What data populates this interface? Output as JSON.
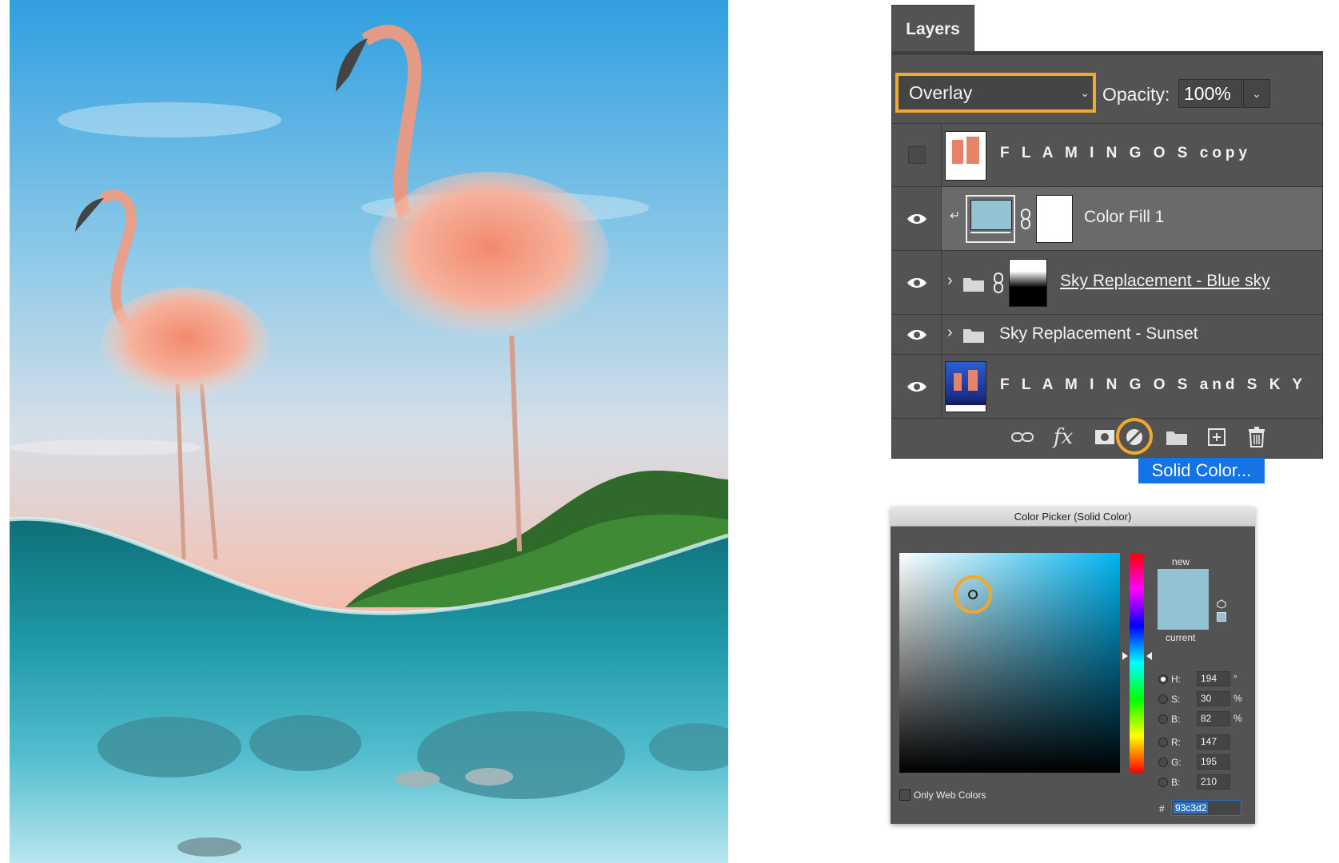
{
  "layers_panel": {
    "tab_label": "Layers",
    "blend_mode": "Overlay",
    "opacity_label": "Opacity:",
    "opacity_value": "100%",
    "layers": [
      {
        "name": "F L A M I N G O S copy",
        "visible": false
      },
      {
        "name": "Color Fill 1",
        "visible": true,
        "selected": true
      },
      {
        "name": "Sky Replacement - Blue sky",
        "visible": true
      },
      {
        "name": "Sky Replacement - Sunset",
        "visible": true
      },
      {
        "name": "F L A M I N G O S and S K Y",
        "visible": true
      }
    ],
    "bottom_tools": [
      "link-icon",
      "fx-icon",
      "mask-icon",
      "adjustment-icon",
      "folder-icon",
      "new-layer-icon",
      "trash-icon"
    ],
    "fx_label": "fx",
    "tooltip": "Solid Color..."
  },
  "color_picker": {
    "title": "Color Picker (Solid Color)",
    "new_label": "new",
    "current_label": "current",
    "fields": [
      {
        "label": "H:",
        "value": "194",
        "unit": "°",
        "selected": true
      },
      {
        "label": "S:",
        "value": "30",
        "unit": "%"
      },
      {
        "label": "B:",
        "value": "82",
        "unit": "%"
      },
      {
        "label": "R:",
        "value": "147",
        "unit": ""
      },
      {
        "label": "G:",
        "value": "195",
        "unit": ""
      },
      {
        "label": "B:",
        "value": "210",
        "unit": ""
      }
    ],
    "only_web_colors_label": "Only Web Colors",
    "hex_label": "#",
    "hex_value": "93c3d2",
    "swatch_color": "#93c3d2"
  },
  "colors": {
    "highlight": "#f0a92d",
    "tooltip_bg": "#1473e6",
    "panel_bg": "#535353"
  }
}
